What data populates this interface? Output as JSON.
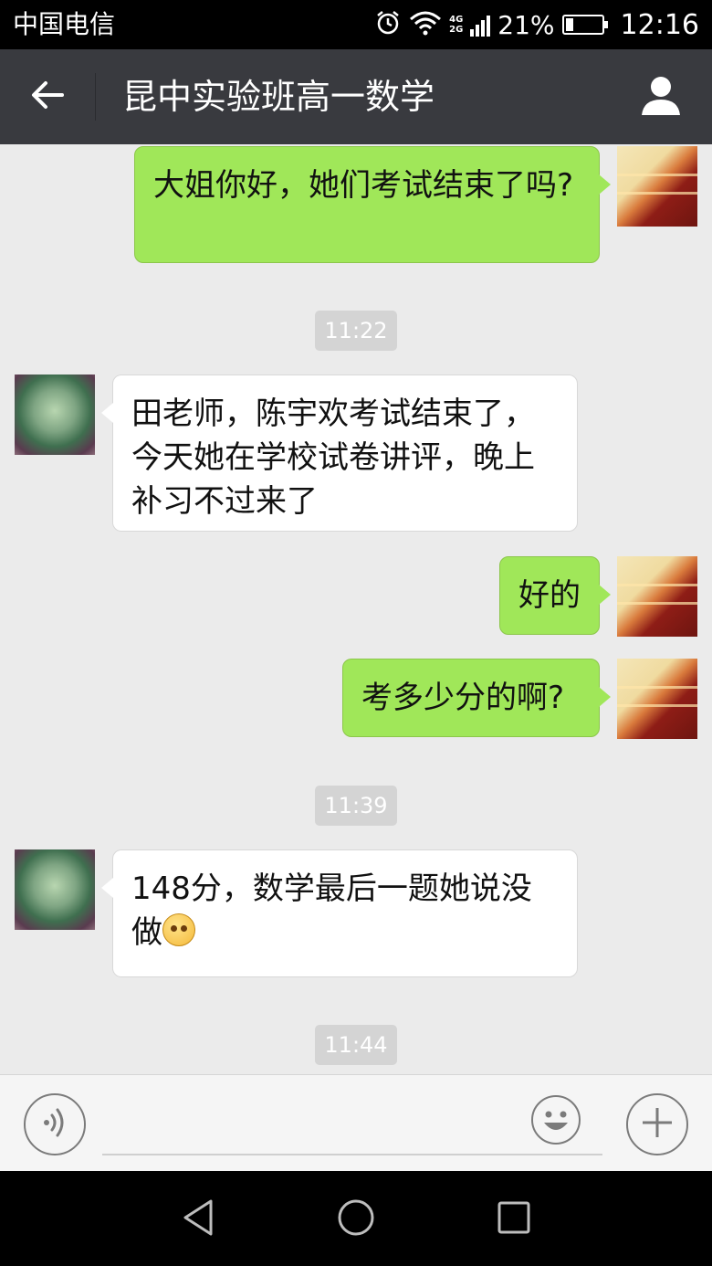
{
  "status_bar": {
    "carrier": "中国电信",
    "network_top": "4G",
    "network_bottom": "2G",
    "battery_percent": "21%",
    "battery_level": 0.21,
    "time": "12:16",
    "icons": [
      "alarm-icon",
      "wifi-icon",
      "signal-icon",
      "battery-icon"
    ]
  },
  "header": {
    "title": "昆中实验班高一数学",
    "back_icon": "arrow-left-icon",
    "profile_icon": "person-icon"
  },
  "messages": [
    {
      "type": "sent",
      "text": "大姐你好，她们考试结束了吗?"
    },
    {
      "type": "timestamp",
      "text": "11:22"
    },
    {
      "type": "received",
      "text": "田老师，陈宇欢考试结束了，今天她在学校试卷讲评，晚上补习不过来了"
    },
    {
      "type": "sent",
      "text": "好的"
    },
    {
      "type": "sent",
      "text": "考多少分的啊?"
    },
    {
      "type": "timestamp",
      "text": "11:39"
    },
    {
      "type": "received",
      "text": "148分，数学最后一题她说没做",
      "emoji": "embarrassed-emoji"
    },
    {
      "type": "timestamp",
      "text": "11:44"
    }
  ],
  "input_bar": {
    "voice_icon": "voice-icon",
    "input_value": "",
    "emoji_icon": "smiley-icon",
    "plus_icon": "plus-icon"
  },
  "nav_bar": {
    "icons": [
      "back-triangle-icon",
      "home-circle-icon",
      "recents-square-icon"
    ]
  },
  "colors": {
    "title_bar": "#393a3f",
    "sent_bubble": "#a0e759",
    "received_bubble": "#ffffff",
    "chat_background": "#ebebeb",
    "timestamp_bg": "#d4d4d4"
  }
}
